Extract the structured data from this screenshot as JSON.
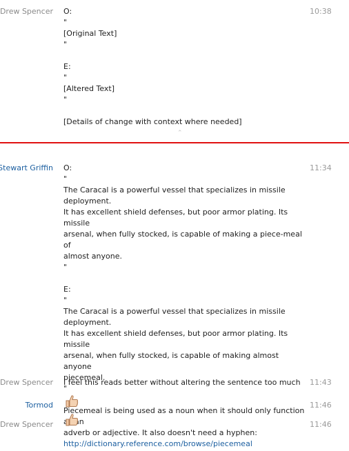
{
  "messages": [
    {
      "sender": "Drew Spencer",
      "time": "10:38",
      "lines": [
        "O:",
        "\"",
        "[Original Text]",
        "\"",
        "",
        "E:",
        "\"",
        "[Altered Text]",
        "\"",
        "",
        "[Details of change with context where needed]"
      ]
    },
    {
      "sender": "Stewart Griffin",
      "time": "11:34",
      "lines": [
        "O:",
        "\"",
        "The Caracal is a powerful vessel that specializes in missile deployment.",
        "It has excellent shield defenses, but poor armor plating. Its missile",
        "arsenal, when fully stocked, is capable of making a piece-meal of",
        "almost anyone.",
        "\"",
        "",
        "E:",
        "\"",
        "The Caracal is a powerful vessel that specializes in missile deployment.",
        "It has excellent shield defenses, but poor armor plating. Its missile",
        "arsenal, when fully stocked, is capable of making almost anyone",
        "piecemeal.",
        "\"",
        "",
        "Piecemeal is being used as a noun when it should only function as an",
        "adverb or adjective.  It also doesn't need a hyphen:"
      ],
      "link": "http://dictionary.reference.com/browse/piecemeal"
    },
    {
      "sender": "Drew Spencer",
      "time": "11:43",
      "text": "I feel this reads better without altering the sentence too much"
    },
    {
      "sender": "Tormod",
      "time": "11:46",
      "emoticon": "thumbs-up-icon"
    },
    {
      "sender": "Drew Spencer",
      "time": "11:46",
      "emoticon": "thumbs-up-icon"
    }
  ],
  "colors": {
    "divider": "#e01010",
    "sender_gray": "#8a8a8a",
    "sender_blue": "#1c5fa0",
    "link": "#1c5fa0"
  }
}
